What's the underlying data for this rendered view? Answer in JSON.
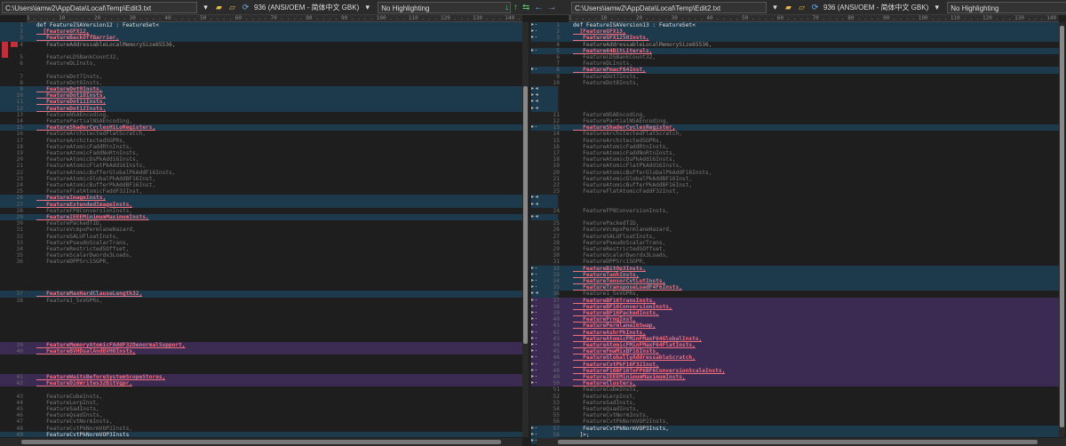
{
  "left": {
    "path": "C:\\Users\\iamw2\\AppData\\Local\\Temp\\Edit3.txt",
    "encoding": "936  (ANSI/OEM - 简体中文 GBK)",
    "highlighting": "No Highlighting"
  },
  "right": {
    "path": "C:\\Users\\iamw2\\AppData\\Local\\Temp\\Edit2.txt",
    "encoding": "936  (ANSI/OEM - 简体中文 GBK)",
    "highlighting": "No Highlighting"
  },
  "ruler": "1 . . . . 10 . . . . 20 . . . . 30 . . . . 40 . . . . 50 . . . . 60 . . . . 70 . . . . 80 . . . . 90 . . . . 100 . . . 110 . . . 120 . . . 130 . . . 140 . . . 150",
  "left_rows": [
    {
      "n": "1",
      "t": "def FeatureISAVersion12 : FeatureSet<",
      "k": "o",
      "b": "c"
    },
    {
      "n": "2",
      "t": "  [FeatureGFX12,",
      "k": "c",
      "b": "c"
    },
    {
      "n": "3",
      "t": "   FeatureBackOffBarrier,",
      "k": "c",
      "b": "c"
    },
    {
      "n": "4",
      "t": "   FeatureAddressableLocalMemorySize65536,",
      "k": "s"
    },
    {
      "n": "",
      "t": "",
      "k": "s"
    },
    {
      "n": "5",
      "t": "   FeatureLDSBankCount32,",
      "k": "d"
    },
    {
      "n": "6",
      "t": "   FeatureDLInsts,",
      "k": "d"
    },
    {
      "n": "",
      "t": "",
      "k": "s"
    },
    {
      "n": "7",
      "t": "   FeatureDot7Insts,",
      "k": "d"
    },
    {
      "n": "8",
      "t": "   FeatureDot8Insts,",
      "k": "d"
    },
    {
      "n": "9",
      "t": "   FeatureDot9Insts,",
      "k": "c",
      "b": "c"
    },
    {
      "n": "10",
      "t": "   FeatureDot10Insts,",
      "k": "c",
      "b": "c"
    },
    {
      "n": "11",
      "t": "   FeatureDot11Insts,",
      "k": "c",
      "b": "c"
    },
    {
      "n": "12",
      "t": "   FeatureDot12Insts,",
      "k": "c",
      "b": "c"
    },
    {
      "n": "13",
      "t": "   FeatureNSAEncoding,",
      "k": "d"
    },
    {
      "n": "14",
      "t": "   FeaturePartialNSAEncoding,",
      "k": "d"
    },
    {
      "n": "15",
      "t": "   FeatureShaderCyclesHiLoRegisters,",
      "k": "c",
      "b": "c"
    },
    {
      "n": "16",
      "t": "   FeatureArchitectedFlatScratch,",
      "k": "d"
    },
    {
      "n": "17",
      "t": "   FeatureArchitectedSGPRs,",
      "k": "d"
    },
    {
      "n": "18",
      "t": "   FeatureAtomicFaddRtnInsts,",
      "k": "d"
    },
    {
      "n": "19",
      "t": "   FeatureAtomicFaddNoRtnInsts,",
      "k": "d"
    },
    {
      "n": "20",
      "t": "   FeatureAtomicDsPkAdd16Insts,",
      "k": "d"
    },
    {
      "n": "21",
      "t": "   FeatureAtomicFlatPkAdd16Insts,",
      "k": "d"
    },
    {
      "n": "22",
      "t": "   FeatureAtomicBufferGlobalPkAddF16Insts,",
      "k": "d"
    },
    {
      "n": "23",
      "t": "   FeatureAtomicGlobalPkAddBF16Inst,",
      "k": "d"
    },
    {
      "n": "24",
      "t": "   FeatureAtomicBufferPkAddBF16Inst,",
      "k": "d"
    },
    {
      "n": "25",
      "t": "   FeatureFlatAtomicFaddF32Inst,",
      "k": "d"
    },
    {
      "n": "26",
      "t": "   FeatureImageInsts,",
      "k": "c",
      "b": "c"
    },
    {
      "n": "27",
      "t": "   FeatureExtendedImageInsts,",
      "k": "c",
      "b": "c"
    },
    {
      "n": "28",
      "t": "   FeatureFP8ConversionInsts,",
      "k": "d"
    },
    {
      "n": "29",
      "t": "   FeatureIEEEMinimumMaximumInsts,",
      "k": "c",
      "b": "c"
    },
    {
      "n": "30",
      "t": "   FeaturePackedTID,",
      "k": "d"
    },
    {
      "n": "31",
      "t": "   FeatureVcmpxPermlaneHazard,",
      "k": "d"
    },
    {
      "n": "32",
      "t": "   FeatureSALUFloatInsts,",
      "k": "d"
    },
    {
      "n": "33",
      "t": "   FeaturePseudoScalarTrans,",
      "k": "d"
    },
    {
      "n": "34",
      "t": "   FeatureRestrictedSOffset,",
      "k": "d"
    },
    {
      "n": "35",
      "t": "   FeatureScalarDwordx3Loads,",
      "k": "d"
    },
    {
      "n": "36",
      "t": "   FeatureDPPSrc1SGPR,",
      "k": "d"
    },
    {
      "n": "",
      "t": "",
      "k": "s"
    },
    {
      "n": "",
      "t": "",
      "k": "s"
    },
    {
      "n": "",
      "t": "",
      "k": "s"
    },
    {
      "n": "",
      "t": "",
      "k": "s"
    },
    {
      "n": "37",
      "t": "   FeatureMaxHardClauseLength32,",
      "k": "c",
      "b": "c"
    },
    {
      "n": "38",
      "t": "   Feature1_5xVGPRs,",
      "k": "d"
    },
    {
      "n": "",
      "t": "",
      "k": "s"
    },
    {
      "n": "",
      "t": "",
      "k": "s"
    },
    {
      "n": "",
      "t": "",
      "k": "s"
    },
    {
      "n": "",
      "t": "",
      "k": "s"
    },
    {
      "n": "",
      "t": "",
      "k": "s"
    },
    {
      "n": "",
      "t": "",
      "k": "s"
    },
    {
      "n": "39",
      "t": "   FeatureMemoryAtomicFAddF32DenormalSupport,",
      "k": "c",
      "b": "u"
    },
    {
      "n": "40",
      "t": "   FeatureBVHDualAndBVH8Insts,",
      "k": "c",
      "b": "u"
    },
    {
      "n": "",
      "t": "",
      "k": "s"
    },
    {
      "n": "",
      "t": "",
      "k": "s"
    },
    {
      "n": "",
      "t": "",
      "k": "s"
    },
    {
      "n": "41",
      "t": "   FeatureWaitsBeforeSystemScopeStores,",
      "k": "c",
      "b": "u"
    },
    {
      "n": "42",
      "t": "   FeatureD16Writes32BitVgpr,",
      "k": "c",
      "b": "u"
    },
    {
      "n": "",
      "t": "",
      "k": "s"
    },
    {
      "n": "43",
      "t": "   FeatureCubeInsts,",
      "k": "d"
    },
    {
      "n": "44",
      "t": "   FeatureLerpInst,",
      "k": "d"
    },
    {
      "n": "45",
      "t": "   FeatureSadInsts,",
      "k": "d"
    },
    {
      "n": "46",
      "t": "   FeatureQsadInsts,",
      "k": "d"
    },
    {
      "n": "47",
      "t": "   FeatureCvtNormInsts,",
      "k": "d"
    },
    {
      "n": "48",
      "t": "   FeatureCvtPkNormVOP2Insts,",
      "k": "d"
    },
    {
      "n": "49",
      "t": "   FeatureCvtPkNormVOP3Insts",
      "k": "o",
      "b": "c"
    },
    {
      "n": "50",
      "t": "  ]>;",
      "k": "o",
      "b": "c"
    }
  ],
  "right_rows": [
    {
      "n": "1",
      "t": "def FeatureISAVersion13 : FeatureSet<",
      "k": "o",
      "b": "c"
    },
    {
      "n": "2",
      "t": "  [FeatureGFX13,",
      "k": "c",
      "b": "c"
    },
    {
      "n": "3",
      "t": "   FeatureGFX1250Insts,",
      "k": "c",
      "b": "c"
    },
    {
      "n": "4",
      "t": "   FeatureAddressableLocalMemorySize65536,",
      "k": "s"
    },
    {
      "n": "5",
      "t": "   Feature64BitLiterals,",
      "k": "c",
      "b": "c"
    },
    {
      "n": "6",
      "t": "   FeatureLDSBankCount32,",
      "k": "d"
    },
    {
      "n": "7",
      "t": "   FeatureDLInsts,",
      "k": "d"
    },
    {
      "n": "8",
      "t": "   FeatureFmacF64Inst,",
      "k": "c",
      "b": "c"
    },
    {
      "n": "9",
      "t": "   FeatureDot7Insts,",
      "k": "d"
    },
    {
      "n": "10",
      "t": "   FeatureDot8Insts,",
      "k": "d"
    },
    {
      "n": "",
      "t": "",
      "k": "s"
    },
    {
      "n": "",
      "t": "",
      "k": "s"
    },
    {
      "n": "",
      "t": "",
      "k": "s"
    },
    {
      "n": "",
      "t": "",
      "k": "s"
    },
    {
      "n": "11",
      "t": "   FeatureNSAEncoding,",
      "k": "d"
    },
    {
      "n": "12",
      "t": "   FeaturePartialNSAEncoding,",
      "k": "d"
    },
    {
      "n": "13",
      "t": "   FeatureShaderCyclesRegister,",
      "k": "c",
      "b": "c"
    },
    {
      "n": "14",
      "t": "   FeatureArchitectedFlatScratch,",
      "k": "d"
    },
    {
      "n": "15",
      "t": "   FeatureArchitectedSGPRs,",
      "k": "d"
    },
    {
      "n": "16",
      "t": "   FeatureAtomicFaddRtnInsts,",
      "k": "d"
    },
    {
      "n": "17",
      "t": "   FeatureAtomicFaddNoRtnInsts,",
      "k": "d"
    },
    {
      "n": "18",
      "t": "   FeatureAtomicDsPkAdd16Insts,",
      "k": "d"
    },
    {
      "n": "19",
      "t": "   FeatureAtomicFlatPkAdd16Insts,",
      "k": "d"
    },
    {
      "n": "20",
      "t": "   FeatureAtomicBufferGlobalPkAddF16Insts,",
      "k": "d"
    },
    {
      "n": "21",
      "t": "   FeatureAtomicGlobalPkAddBF16Inst,",
      "k": "d"
    },
    {
      "n": "22",
      "t": "   FeatureAtomicBufferPkAddBF16Inst,",
      "k": "d"
    },
    {
      "n": "23",
      "t": "   FeatureFlatAtomicFaddF32Inst,",
      "k": "d"
    },
    {
      "n": "",
      "t": "",
      "k": "s"
    },
    {
      "n": "",
      "t": "",
      "k": "s"
    },
    {
      "n": "24",
      "t": "   FeatureFP8ConversionInsts,",
      "k": "d"
    },
    {
      "n": "",
      "t": "",
      "k": "s"
    },
    {
      "n": "25",
      "t": "   FeaturePackedTID,",
      "k": "d"
    },
    {
      "n": "26",
      "t": "   FeatureVcmpxPermlaneHazard,",
      "k": "d"
    },
    {
      "n": "27",
      "t": "   FeatureSALUFloatInsts,",
      "k": "d"
    },
    {
      "n": "28",
      "t": "   FeaturePseudoScalarTrans,",
      "k": "d"
    },
    {
      "n": "29",
      "t": "   FeatureRestrictedSOffset,",
      "k": "d"
    },
    {
      "n": "30",
      "t": "   FeatureScalarDwordx3Loads,",
      "k": "d"
    },
    {
      "n": "31",
      "t": "   FeatureDPPSrc1SGPR,",
      "k": "d"
    },
    {
      "n": "32",
      "t": "   FeatureBitOp3Insts,",
      "k": "c",
      "b": "c"
    },
    {
      "n": "33",
      "t": "   FeatureTanhInsts,",
      "k": "c",
      "b": "c"
    },
    {
      "n": "34",
      "t": "   FeatureTensorCvtLutInsts,",
      "k": "c",
      "b": "c"
    },
    {
      "n": "35",
      "t": "   FeatureTransposeLoadF4F6Insts,",
      "k": "c",
      "b": "c"
    },
    {
      "n": "36",
      "t": "   Feature1_5xVGPRs,",
      "k": "d"
    },
    {
      "n": "37",
      "t": "   FeatureBF16TransInsts,",
      "k": "c",
      "b": "u"
    },
    {
      "n": "38",
      "t": "   FeatureBF16ConversionInsts,",
      "k": "c",
      "b": "u"
    },
    {
      "n": "39",
      "t": "   FeatureBF16PackedInsts,",
      "k": "c",
      "b": "u"
    },
    {
      "n": "40",
      "t": "   FeaturePrngInst,",
      "k": "c",
      "b": "u"
    },
    {
      "n": "41",
      "t": "   FeaturePermlane16Swap,",
      "k": "c",
      "b": "u"
    },
    {
      "n": "42",
      "t": "   FeatureAshrPkInsts,",
      "k": "c",
      "b": "u"
    },
    {
      "n": "43",
      "t": "   FeatureAtomicFMinFMaxF64GlobalInsts,",
      "k": "c",
      "b": "u"
    },
    {
      "n": "44",
      "t": "   FeatureAtomicFMinFMaxF64FlatInsts,",
      "k": "c",
      "b": "u"
    },
    {
      "n": "45",
      "t": "   FeatureFmaMixBF16Insts,",
      "k": "c",
      "b": "u"
    },
    {
      "n": "46",
      "t": "   FeatureGloballyAddressableScratch,",
      "k": "c",
      "b": "u"
    },
    {
      "n": "47",
      "t": "   FeatureCvtPkF16F32Inst,",
      "k": "c",
      "b": "u"
    },
    {
      "n": "48",
      "t": "   FeatureF16BF16ToFP6BF6ConversionScaleInsts,",
      "k": "c",
      "b": "u"
    },
    {
      "n": "49",
      "t": "   FeatureIEEEMinimumMaximumInsts,",
      "k": "c",
      "b": "u"
    },
    {
      "n": "50",
      "t": "   FeatureClusters,",
      "k": "c",
      "b": "u"
    },
    {
      "n": "51",
      "t": "   FeatureCubeInsts,",
      "k": "d"
    },
    {
      "n": "52",
      "t": "   FeatureLerpInst,",
      "k": "d"
    },
    {
      "n": "53",
      "t": "   FeatureSadInsts,",
      "k": "d"
    },
    {
      "n": "54",
      "t": "   FeatureQsadInsts,",
      "k": "d"
    },
    {
      "n": "55",
      "t": "   FeatureCvtNormInsts,",
      "k": "d"
    },
    {
      "n": "56",
      "t": "   FeatureCvtPkNormVOP2Insts,",
      "k": "d"
    },
    {
      "n": "57",
      "t": "   FeatureCvtPkNormVOP3Insts,",
      "k": "o",
      "b": "c"
    },
    {
      "n": "58",
      "t": "  ]>;",
      "k": "o",
      "b": "c"
    }
  ],
  "colors": {
    "background": "#1e1e1e",
    "changed_bg": "#1d3a4c",
    "unique_bg": "#3b2b52",
    "changed_text": "#f07080"
  }
}
